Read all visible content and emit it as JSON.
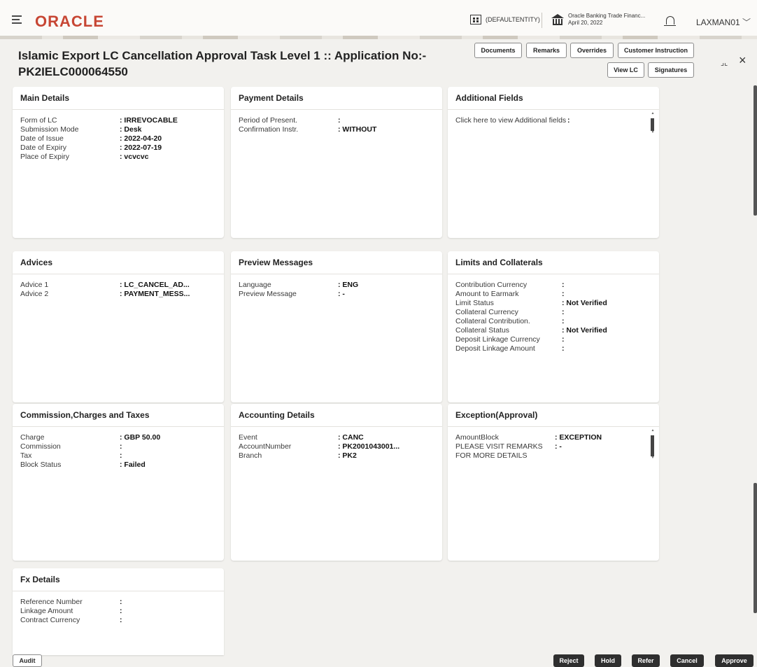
{
  "header": {
    "logo": "ORACLE",
    "entity": "(DEFAULTENTITY)",
    "bank_name": "Oracle Banking Trade Financ...",
    "bank_date": "April 20, 2022",
    "user": "LAXMAN01"
  },
  "page": {
    "title_line1": "Islamic Export LC Cancellation Approval Task Level 1 :: Application No:-",
    "title_line2": "PK2IELC000064550"
  },
  "toolbar": {
    "documents": "Documents",
    "remarks": "Remarks",
    "overrides": "Overrides",
    "customer_instruction": "Customer Instruction",
    "view_lc": "View LC",
    "signatures": "Signatures",
    "minimize": "⌟⌞",
    "close": "×"
  },
  "panels": {
    "main_details": {
      "title": "Main Details",
      "rows": [
        {
          "label": "Form of LC",
          "value": ": IRREVOCABLE"
        },
        {
          "label": "Submission Mode",
          "value": ": Desk"
        },
        {
          "label": "Date of Issue",
          "value": ": 2022-04-20"
        },
        {
          "label": "Date of Expiry",
          "value": ": 2022-07-19"
        },
        {
          "label": "Place of Expiry",
          "value": ": vcvcvc"
        }
      ]
    },
    "payment_details": {
      "title": "Payment Details",
      "rows": [
        {
          "label": "Period of Present.",
          "value": ":"
        },
        {
          "label": "Confirmation Instr.",
          "value": ": WITHOUT"
        }
      ]
    },
    "additional_fields": {
      "title": "Additional Fields",
      "rows": [
        {
          "label": "Click here to view Additional fields",
          "value": ":"
        }
      ]
    },
    "advices": {
      "title": "Advices",
      "rows": [
        {
          "label": "Advice 1",
          "value": ": LC_CANCEL_AD..."
        },
        {
          "label": "Advice 2",
          "value": ": PAYMENT_MESS..."
        }
      ]
    },
    "preview_messages": {
      "title": "Preview Messages",
      "rows": [
        {
          "label": "Language",
          "value": ": ENG"
        },
        {
          "label": "Preview Message",
          "value": ": -"
        }
      ]
    },
    "limits_collaterals": {
      "title": "Limits and Collaterals",
      "rows": [
        {
          "label": "Contribution Currency",
          "value": ":"
        },
        {
          "label": "Amount to Earmark",
          "value": ":"
        },
        {
          "label": "Limit Status",
          "value": ": Not Verified"
        },
        {
          "label": "Collateral Currency",
          "value": ":"
        },
        {
          "label": "Collateral Contribution.",
          "value": ":"
        },
        {
          "label": "Collateral Status",
          "value": ": Not Verified"
        },
        {
          "label": "Deposit Linkage Currency",
          "value": ":"
        },
        {
          "label": "Deposit Linkage Amount",
          "value": ":"
        }
      ]
    },
    "commission_charges": {
      "title": "Commission,Charges and Taxes",
      "rows": [
        {
          "label": "Charge",
          "value": ": GBP  50.00"
        },
        {
          "label": "Commission",
          "value": ":"
        },
        {
          "label": "Tax",
          "value": ":"
        },
        {
          "label": "Block Status",
          "value": ": Failed"
        }
      ]
    },
    "accounting_details": {
      "title": "Accounting Details",
      "rows": [
        {
          "label": "Event",
          "value": ": CANC"
        },
        {
          "label": "AccountNumber",
          "value": ": PK2001043001..."
        },
        {
          "label": "Branch",
          "value": ": PK2"
        }
      ]
    },
    "exception_approval": {
      "title": "Exception(Approval)",
      "rows": [
        {
          "label": "AmountBlock",
          "value": ": EXCEPTION"
        },
        {
          "label": "PLEASE VISIT REMARKS FOR MORE DETAILS",
          "value": ": -"
        }
      ]
    },
    "fx_details": {
      "title": "Fx Details",
      "rows": [
        {
          "label": "Reference Number",
          "value": ":"
        },
        {
          "label": "Linkage Amount",
          "value": ":"
        },
        {
          "label": "Contract Currency",
          "value": ":"
        }
      ]
    }
  },
  "footer": {
    "audit": "Audit",
    "reject": "Reject",
    "hold": "Hold",
    "refer": "Refer",
    "cancel": "Cancel",
    "approve": "Approve"
  }
}
